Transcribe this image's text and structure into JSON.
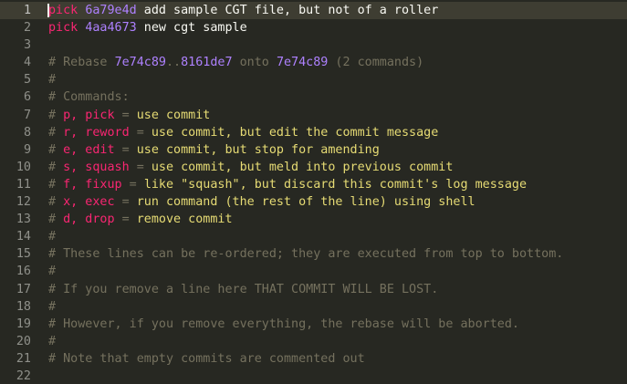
{
  "editor": {
    "lines": [
      {
        "num": "1",
        "tokens": [
          {
            "t": "kw",
            "v": "pick"
          },
          {
            "t": "text",
            "v": " "
          },
          {
            "t": "hash",
            "v": "6a79e4d"
          },
          {
            "t": "text",
            "v": " add sample CGT file, but not of a roller"
          }
        ]
      },
      {
        "num": "2",
        "tokens": [
          {
            "t": "kw",
            "v": "pick"
          },
          {
            "t": "text",
            "v": " "
          },
          {
            "t": "hash",
            "v": "4aa4673"
          },
          {
            "t": "text",
            "v": " new cgt sample"
          }
        ]
      },
      {
        "num": "3",
        "tokens": []
      },
      {
        "num": "4",
        "tokens": [
          {
            "t": "com",
            "v": "# Rebase "
          },
          {
            "t": "hash",
            "v": "7e74c89"
          },
          {
            "t": "com",
            "v": ".."
          },
          {
            "t": "hash",
            "v": "8161de7"
          },
          {
            "t": "com",
            "v": " onto "
          },
          {
            "t": "hash",
            "v": "7e74c89"
          },
          {
            "t": "com",
            "v": " (2 commands)"
          }
        ]
      },
      {
        "num": "5",
        "tokens": [
          {
            "t": "com",
            "v": "#"
          }
        ]
      },
      {
        "num": "6",
        "tokens": [
          {
            "t": "com",
            "v": "# Commands:"
          }
        ]
      },
      {
        "num": "7",
        "tokens": [
          {
            "t": "com",
            "v": "# "
          },
          {
            "t": "op",
            "v": "p, pick"
          },
          {
            "t": "com",
            "v": " = "
          },
          {
            "t": "desc",
            "v": "use commit"
          }
        ]
      },
      {
        "num": "8",
        "tokens": [
          {
            "t": "com",
            "v": "# "
          },
          {
            "t": "op",
            "v": "r, reword"
          },
          {
            "t": "com",
            "v": " = "
          },
          {
            "t": "desc",
            "v": "use commit, but edit the commit message"
          }
        ]
      },
      {
        "num": "9",
        "tokens": [
          {
            "t": "com",
            "v": "# "
          },
          {
            "t": "op",
            "v": "e, edit"
          },
          {
            "t": "com",
            "v": " = "
          },
          {
            "t": "desc",
            "v": "use commit, but stop for amending"
          }
        ]
      },
      {
        "num": "10",
        "tokens": [
          {
            "t": "com",
            "v": "# "
          },
          {
            "t": "op",
            "v": "s, squash"
          },
          {
            "t": "com",
            "v": " = "
          },
          {
            "t": "desc",
            "v": "use commit, but meld into previous commit"
          }
        ]
      },
      {
        "num": "11",
        "tokens": [
          {
            "t": "com",
            "v": "# "
          },
          {
            "t": "op",
            "v": "f, fixup"
          },
          {
            "t": "com",
            "v": " = "
          },
          {
            "t": "desc",
            "v": "like \"squash\", but discard this commit's log message"
          }
        ]
      },
      {
        "num": "12",
        "tokens": [
          {
            "t": "com",
            "v": "# "
          },
          {
            "t": "op",
            "v": "x, exec"
          },
          {
            "t": "com",
            "v": " = "
          },
          {
            "t": "desc",
            "v": "run command (the rest of the line) using shell"
          }
        ]
      },
      {
        "num": "13",
        "tokens": [
          {
            "t": "com",
            "v": "# "
          },
          {
            "t": "op",
            "v": "d, drop"
          },
          {
            "t": "com",
            "v": " = "
          },
          {
            "t": "desc",
            "v": "remove commit"
          }
        ]
      },
      {
        "num": "14",
        "tokens": [
          {
            "t": "com",
            "v": "#"
          }
        ]
      },
      {
        "num": "15",
        "tokens": [
          {
            "t": "com",
            "v": "# These lines can be re-ordered; they are executed from top to bottom."
          }
        ]
      },
      {
        "num": "16",
        "tokens": [
          {
            "t": "com",
            "v": "#"
          }
        ]
      },
      {
        "num": "17",
        "tokens": [
          {
            "t": "com",
            "v": "# If you remove a line here THAT COMMIT WILL BE LOST."
          }
        ]
      },
      {
        "num": "18",
        "tokens": [
          {
            "t": "com",
            "v": "#"
          }
        ]
      },
      {
        "num": "19",
        "tokens": [
          {
            "t": "com",
            "v": "# However, if you remove everything, the rebase will be aborted."
          }
        ]
      },
      {
        "num": "20",
        "tokens": [
          {
            "t": "com",
            "v": "#"
          }
        ]
      },
      {
        "num": "21",
        "tokens": [
          {
            "t": "com",
            "v": "# Note that empty commits are commented out"
          }
        ]
      },
      {
        "num": "22",
        "tokens": []
      }
    ]
  },
  "theme": {
    "background": "#272822",
    "keyword": "#f92672",
    "hash": "#ae81ff",
    "text": "#f8f8f2",
    "comment": "#75715e",
    "description": "#e6db74"
  }
}
